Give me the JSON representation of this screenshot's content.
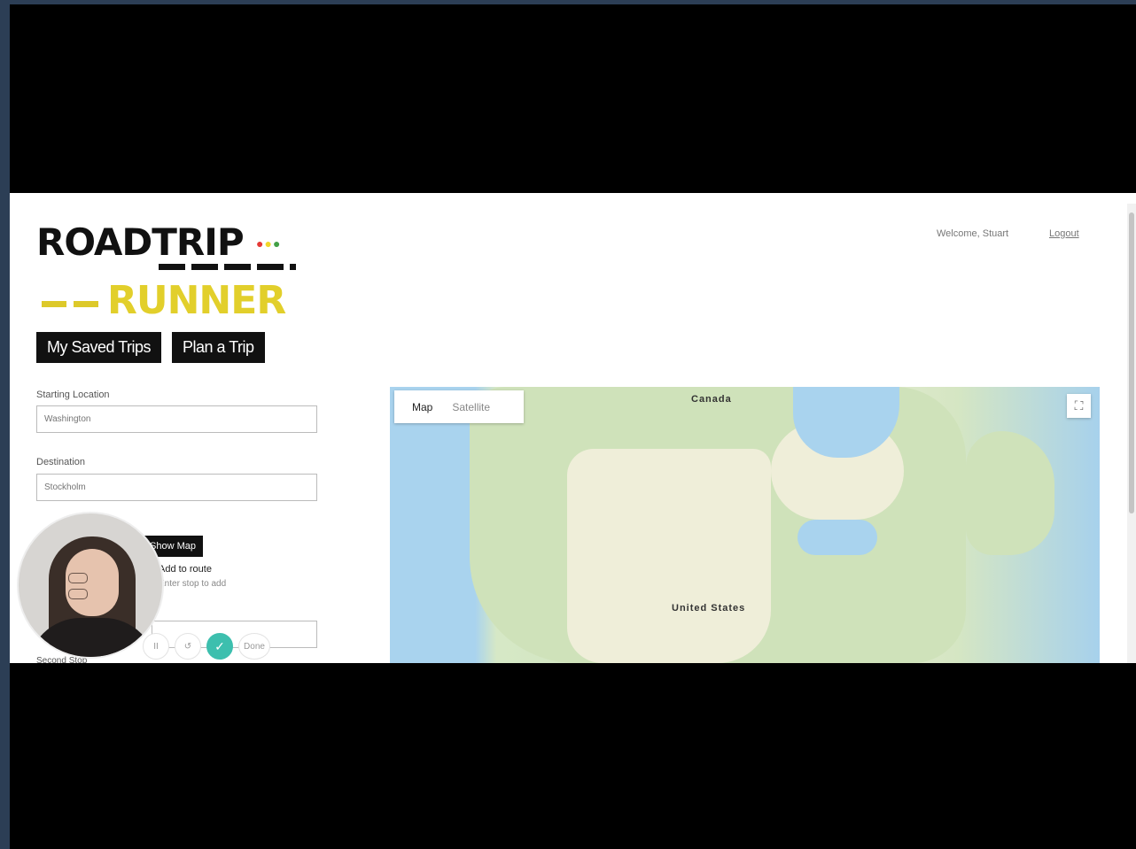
{
  "logo": {
    "line1": "ROADTRIP",
    "line2": "RUNNER"
  },
  "header": {
    "welcome": "Welcome, Stuart",
    "logout": "Logout"
  },
  "nav": {
    "saved_trips": "My Saved Trips",
    "plan_trip": "Plan a Trip"
  },
  "form": {
    "start_label": "Starting Location",
    "start_placeholder": "Washington",
    "dest_label": "Destination",
    "dest_placeholder": "Stockholm",
    "show_map": "Show Map",
    "add_route": "Add to route",
    "add_hint": "Enter stop to add",
    "second_stop_label": "Second Stop"
  },
  "map": {
    "tab_map": "Map",
    "tab_satellite": "Satellite",
    "label_canada": "Canada",
    "label_us": "United States"
  },
  "recorder": {
    "done_label": "Done"
  },
  "colors": {
    "logo_yellow": "#e2cf2b",
    "dark": "#111111",
    "record_teal": "#3dbfae"
  }
}
